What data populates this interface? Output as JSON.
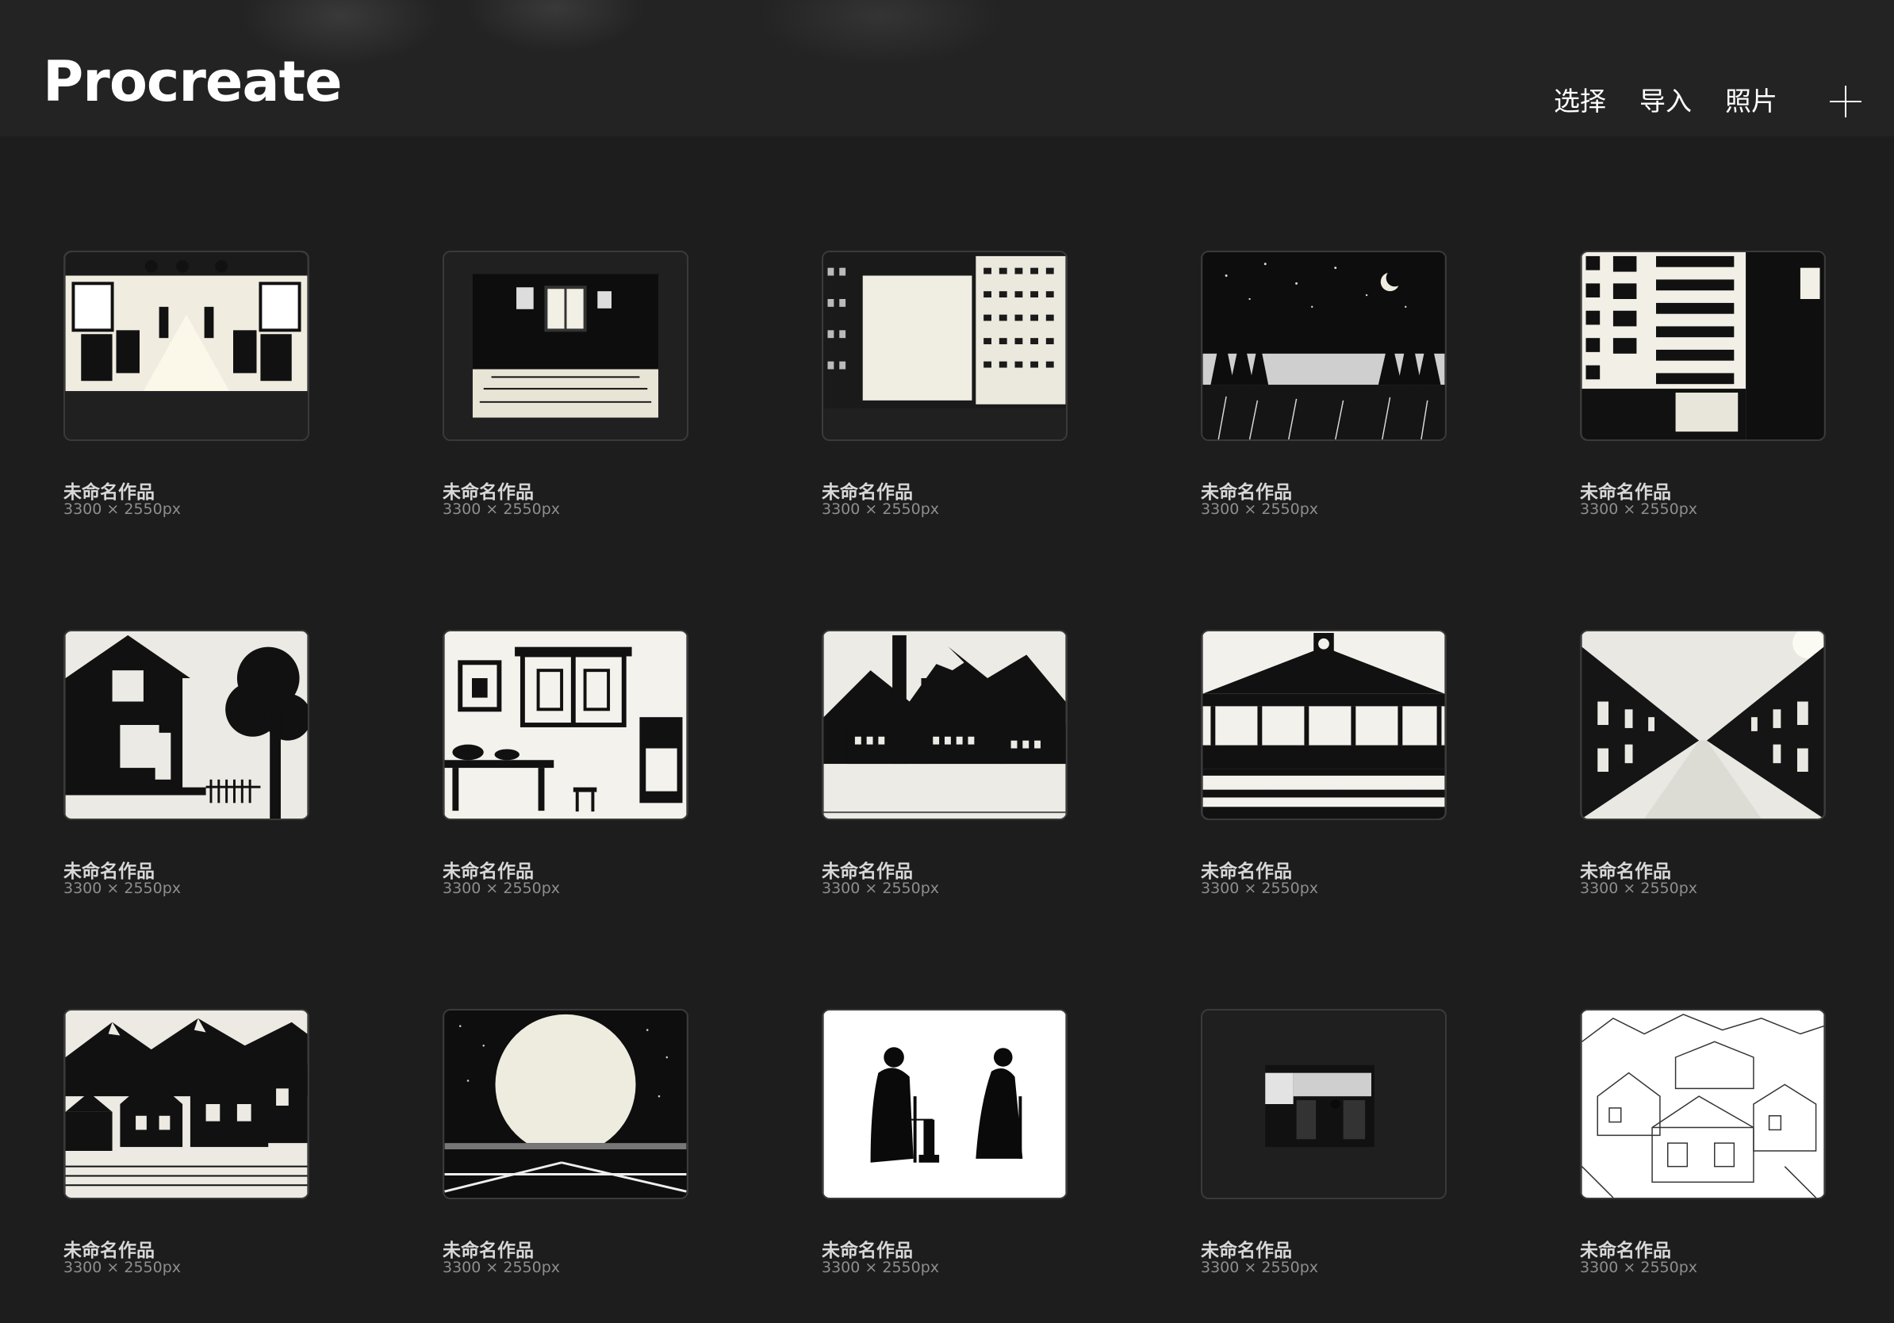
{
  "app": {
    "title": "Procreate"
  },
  "toolbar": {
    "select_label": "选择",
    "import_label": "导入",
    "photo_label": "照片",
    "add_icon": "plus-icon"
  },
  "gallery": {
    "items": [
      {
        "title": "未命名作品",
        "size": "3300 × 2550px",
        "thumb": "train-carriage-interior"
      },
      {
        "title": "未命名作品",
        "size": "3300 × 2550px",
        "thumb": "room-interior"
      },
      {
        "title": "未命名作品",
        "size": "3300 × 2550px",
        "thumb": "buildings-blank-billboard"
      },
      {
        "title": "未命名作品",
        "size": "3300 × 2550px",
        "thumb": "night-forest-moon"
      },
      {
        "title": "未命名作品",
        "size": "3300 × 2550px",
        "thumb": "apartment-block"
      },
      {
        "title": "未命名作品",
        "size": "3300 × 2550px",
        "thumb": "house-with-tree"
      },
      {
        "title": "未命名作品",
        "size": "3300 × 2550px",
        "thumb": "traditional-interior"
      },
      {
        "title": "未命名作品",
        "size": "3300 × 2550px",
        "thumb": "factory-mountains"
      },
      {
        "title": "未命名作品",
        "size": "3300 × 2550px",
        "thumb": "train-station"
      },
      {
        "title": "未命名作品",
        "size": "3300 × 2550px",
        "thumb": "terraced-street"
      },
      {
        "title": "未命名作品",
        "size": "3300 × 2550px",
        "thumb": "row-houses-mountains"
      },
      {
        "title": "未命名作品",
        "size": "3300 × 2550px",
        "thumb": "full-moon"
      },
      {
        "title": "未命名作品",
        "size": "3300 × 2550px",
        "thumb": "elderly-couple-silhouette"
      },
      {
        "title": "未命名作品",
        "size": "3300 × 2550px",
        "thumb": "small-train-window"
      },
      {
        "title": "未命名作品",
        "size": "3300 × 2550px",
        "thumb": "village-line-sketch"
      }
    ]
  },
  "colors": {
    "background": "#1d1d1d",
    "header": "#232323",
    "title_text": "#d8d8d8",
    "meta_text": "#8e8e8e"
  }
}
